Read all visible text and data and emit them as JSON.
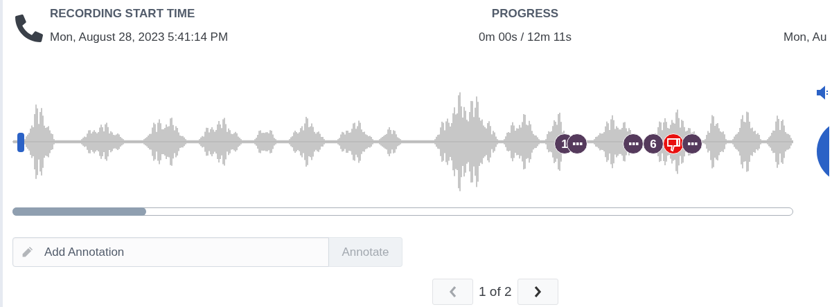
{
  "header": {
    "start_label": "RECORDING START TIME",
    "start_value": "Mon, August 28, 2023 5:41:14 PM",
    "progress_label": "PROGRESS",
    "progress_value": "0m 00s / 12m 11s",
    "end_value": "Mon, Au"
  },
  "markers": [
    {
      "kind": "number",
      "label": "1",
      "color": "#553a5c"
    },
    {
      "kind": "comment",
      "color": "#553a5c"
    },
    {
      "kind": "comment",
      "color": "#553a5c"
    },
    {
      "kind": "number",
      "label": "6",
      "color": "#553a5c"
    },
    {
      "kind": "dislike",
      "color": "#e8100f"
    },
    {
      "kind": "comment",
      "color": "#553a5c"
    }
  ],
  "annotation": {
    "placeholder": "Add Annotation",
    "button": "Annotate",
    "button_disabled": true
  },
  "pagination": {
    "text": "1 of 2",
    "prev_disabled": true,
    "next_disabled": false
  }
}
